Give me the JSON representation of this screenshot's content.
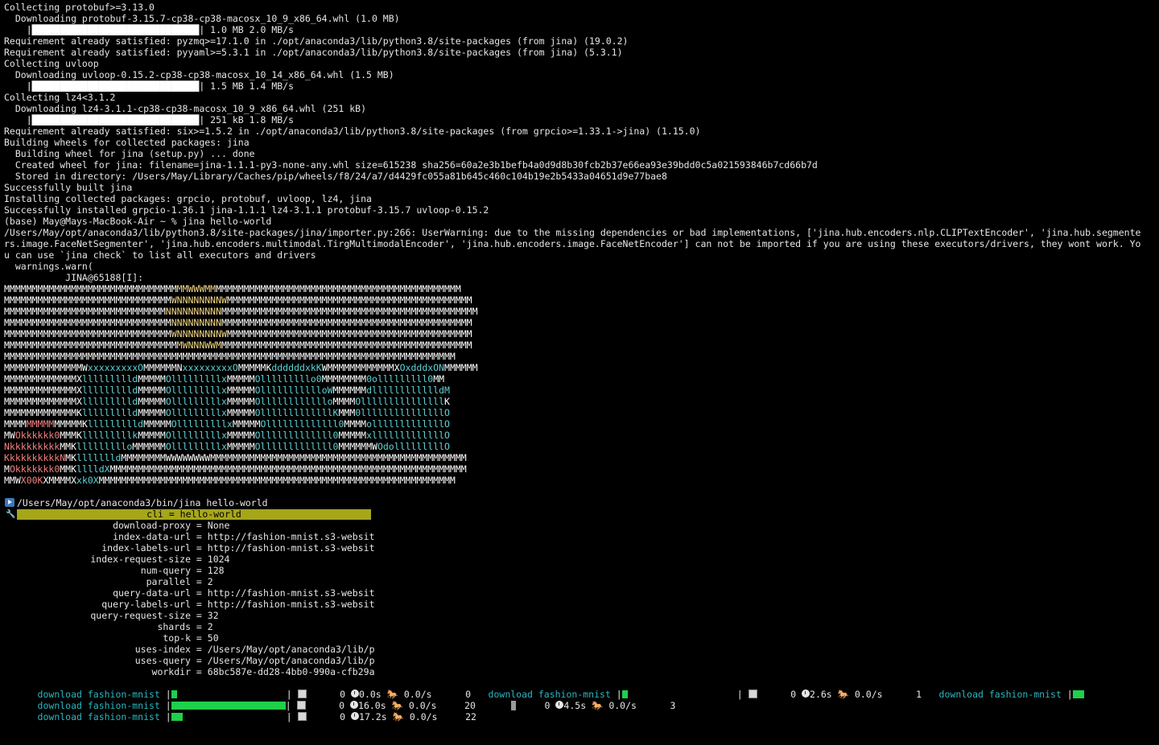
{
  "install_log": [
    "Collecting protobuf>=3.13.0",
    "  Downloading protobuf-3.15.7-cp38-cp38-macosx_10_9_x86_64.whl (1.0 MB)",
    "@BAR@| 1.0 MB 2.0 MB/s",
    "Requirement already satisfied: pyzmq>=17.1.0 in ./opt/anaconda3/lib/python3.8/site-packages (from jina) (19.0.2)",
    "Requirement already satisfied: pyyaml>=5.3.1 in ./opt/anaconda3/lib/python3.8/site-packages (from jina) (5.3.1)",
    "Collecting uvloop",
    "  Downloading uvloop-0.15.2-cp38-cp38-macosx_10_14_x86_64.whl (1.5 MB)",
    "@BAR@| 1.5 MB 1.4 MB/s",
    "Collecting lz4<3.1.2",
    "  Downloading lz4-3.1.1-cp38-cp38-macosx_10_9_x86_64.whl (251 kB)",
    "@BAR@| 251 kB 1.8 MB/s",
    "Requirement already satisfied: six>=1.5.2 in ./opt/anaconda3/lib/python3.8/site-packages (from grpcio>=1.33.1->jina) (1.15.0)",
    "Building wheels for collected packages: jina",
    "  Building wheel for jina (setup.py) ... done",
    "  Created wheel for jina: filename=jina-1.1.1-py3-none-any.whl size=615238 sha256=60a2e3b1befb4a0d9d8b30fcb2b37e66ea93e39bdd0c5a021593846b7cd66b7d",
    "  Stored in directory: /Users/May/Library/Caches/pip/wheels/f8/24/a7/d4429fc055a81b645c460c104b19e2b5433a04651d9e77bae8",
    "Successfully built jina",
    "Installing collected packages: grpcio, protobuf, uvloop, lz4, jina",
    "Successfully installed grpcio-1.36.1 jina-1.1.1 lz4-3.1.1 protobuf-3.15.7 uvloop-0.15.2",
    "(base) May@Mays-MacBook-Air ~ % jina hello-world",
    "/Users/May/opt/anaconda3/lib/python3.8/site-packages/jina/importer.py:266: UserWarning: due to the missing dependencies or bad implementations, ['jina.hub.encoders.nlp.CLIPTextEncoder', 'jina.hub.segmente",
    "rs.image.FaceNetSegmenter', 'jina.hub.encoders.multimodal.TirgMultimodalEncoder', 'jina.hub.encoders.image.FaceNetEncoder'] can not be imported if you are using these executors/drivers, they wont work. Yo",
    "u can use `jina check` to list all executors and drivers",
    "  warnings.warn(",
    "           JINA@65188[I]:"
  ],
  "bar_glyphs": "    |██████████████████████████████",
  "logo": [
    [
      [
        "w",
        "MMMMMMMMMMMMMMMMMMMMMMMMMMMMMMM"
      ],
      [
        "y",
        "MMWWWMM"
      ],
      [
        "w",
        "MMMMMMMMMMMMMMMMMMMMMMMMMMMMMMMMMMMMMMMMMMMM"
      ]
    ],
    [
      [
        "w",
        "MMMMMMMMMMMMMMMMMMMMMMMMMMMMMM"
      ],
      [
        "y",
        "WNNNNNNNNW"
      ],
      [
        "w",
        "MMMMMMMMMMMMMMMMMMMMMMMMMMMMMMMMMMMMMMMMMMMM"
      ]
    ],
    [
      [
        "w",
        "MMMMMMMMMMMMMMMMMMMMMMMMMMMMM"
      ],
      [
        "y",
        "NNNNNNNNNN"
      ],
      [
        "w",
        "MMMMMMMMMMMMMMMMMMMMMMMMMMMMMMMMMMMMMMMMMMMMMM"
      ]
    ],
    [
      [
        "w",
        "MMMMMMMMMMMMMMMMMMMMMMMMMMMMMM"
      ],
      [
        "y",
        "NNNNNNNNN"
      ],
      [
        "w",
        "MMMMMMMMMMMMMMMMMMMMMMMMMMMMMMMMMMMMMMMMMMMMM"
      ]
    ],
    [
      [
        "w",
        "MMMMMMMMMMMMMMMMMMMMMMMMMMMMMM"
      ],
      [
        "y",
        "WNNNNNNNNW"
      ],
      [
        "w",
        "MMMMMMMMMMMMMMMMMMMMMMMMMMMMMMMMMMMMMMMMMMMM"
      ]
    ],
    [
      [
        "w",
        "MMMMMMMMMMMMMMMMMMMMMMMMMMMMMMM"
      ],
      [
        "y",
        "MWNNNWWM"
      ],
      [
        "w",
        "MMMMMMMMMMMMMMMMMMMMMMMMMMMMMMMMMMMMMMMMMMMMM"
      ]
    ],
    [
      [
        "w",
        "MMMMMMMMMMMMMMMMMMMMMMMMMMMMMMMMMMMMMMMMMMMMMMMMMMMMMMMMMMMMMMMMMMMMMMMMMMMMMMMMM"
      ]
    ],
    [
      [
        "w",
        "MMMMMMMMMMMMMMW"
      ],
      [
        "c",
        "xxxxxxxxxO"
      ],
      [
        "w",
        "MMMMMMN"
      ],
      [
        "c",
        "xxxxxxxxxO"
      ],
      [
        "w",
        "MMMMMK"
      ],
      [
        "c",
        "ddddddxkK"
      ],
      [
        "w",
        "WMMMMMMMMMMMMX"
      ],
      [
        "c",
        "OxdddxON"
      ],
      [
        "w",
        "MMMMMM"
      ]
    ],
    [
      [
        "w",
        "MMMMMMMMMMMMMX"
      ],
      [
        "c",
        "llllllllld"
      ],
      [
        "w",
        "MMMMM"
      ],
      [
        "c",
        "Olllllllllx"
      ],
      [
        "w",
        "MMMMM"
      ],
      [
        "c",
        "Olllllllllo0"
      ],
      [
        "w",
        "MMMMMMMM"
      ],
      [
        "c",
        "0olllllllll0"
      ],
      [
        "w",
        "MM"
      ]
    ],
    [
      [
        "w",
        "MMMMMMMMMMMMMX"
      ],
      [
        "c",
        "llllllllld"
      ],
      [
        "w",
        "MMMMM"
      ],
      [
        "c",
        "Olllllllllx"
      ],
      [
        "w",
        "MMMMM"
      ],
      [
        "c",
        "OllllllllllloW"
      ],
      [
        "w",
        "MMMMMM"
      ],
      [
        "c",
        "dlllllllllllldM"
      ]
    ],
    [
      [
        "w",
        "MMMMMMMMMMMMMX"
      ],
      [
        "c",
        "llllllllld"
      ],
      [
        "w",
        "MMMMM"
      ],
      [
        "c",
        "Olllllllllx"
      ],
      [
        "w",
        "MMMMM"
      ],
      [
        "c",
        "Ollllllllllllo"
      ],
      [
        "w",
        "MMMM"
      ],
      [
        "c",
        "Olllllllllllllll"
      ],
      [
        "w",
        "K"
      ]
    ],
    [
      [
        "w",
        "MMMMMMMMMMMMMK"
      ],
      [
        "c",
        "llllllllld"
      ],
      [
        "w",
        "MMMMM"
      ],
      [
        "c",
        "Olllllllllx"
      ],
      [
        "w",
        "MMMMM"
      ],
      [
        "c",
        "OlllllllllllllK"
      ],
      [
        "w",
        "MMM"
      ],
      [
        "c",
        "0lllllllllllllllO"
      ]
    ],
    [
      [
        "w",
        "MMMM"
      ],
      [
        "r",
        "MMMMM"
      ],
      [
        "w",
        "MMMMMK"
      ],
      [
        "c",
        "llllllllld"
      ],
      [
        "w",
        "MMMMM"
      ],
      [
        "c",
        "Olllllllllx"
      ],
      [
        "w",
        "MMMMM"
      ],
      [
        "c",
        "Olllllllllllll0"
      ],
      [
        "w",
        "MMMM"
      ],
      [
        "c",
        "olllllllllllllO"
      ]
    ],
    [
      [
        "w",
        "MW"
      ],
      [
        "r",
        "Okkkkkk0"
      ],
      [
        "w",
        "MMMK"
      ],
      [
        "c",
        "lllllllllk"
      ],
      [
        "w",
        "MMMMM"
      ],
      [
        "c",
        "Olllllllllx"
      ],
      [
        "w",
        "MMMMM"
      ],
      [
        "c",
        "Olllllllllllll0"
      ],
      [
        "w",
        "MMMMM"
      ],
      [
        "c",
        "xlllllllllllllO"
      ]
    ],
    [
      [
        "r",
        "Nkkkkkkkkk"
      ],
      [
        "w",
        "MMK"
      ],
      [
        "c",
        "lllllllllo"
      ],
      [
        "w",
        "MMMMMM"
      ],
      [
        "c",
        "Olllllllllx"
      ],
      [
        "w",
        "MMMMM"
      ],
      [
        "c",
        "Olllllllllllll0"
      ],
      [
        "w",
        "MMMMMMW"
      ],
      [
        "c",
        "OdolllllllllO"
      ]
    ],
    [
      [
        "r",
        "KkkkkkkkkkN"
      ],
      [
        "w",
        "MK"
      ],
      [
        "c",
        "llllllld"
      ],
      [
        "w",
        "MMMMMMMMWWWWWWWW"
      ],
      [
        "w",
        "MMMMMMMMMMMMMMMMMMMMMMMMMMMMMMMMMMMMMMMMMMMMMM"
      ]
    ],
    [
      [
        "w",
        "M"
      ],
      [
        "r",
        "Okkkkkkk0"
      ],
      [
        "w",
        "MMK"
      ],
      [
        "c",
        "lllldX"
      ],
      [
        "w",
        "MMMMMMMMMMMMMMMMMMMMMMMMMMMMMMMMMMMMMMMMMMMMMMMMMMMMMMMMMMMMMMMM"
      ]
    ],
    [
      [
        "w",
        "MMW"
      ],
      [
        "r",
        "X00K"
      ],
      [
        "w",
        "XMMMMX"
      ],
      [
        "c",
        "xk0X"
      ],
      [
        "w",
        "MMMMMMMMMMMMMMMMMMMMMMMMMMMMMMMMMMMMMMMMMMMMMMMMMMMMMMMMMMMMMMMM"
      ]
    ]
  ],
  "run_header": {
    "path": "/Users/May/opt/anaconda3/bin/jina hello-world",
    "cli": "cli = hello-world"
  },
  "args": [
    {
      "k": "download-proxy",
      "v": "None"
    },
    {
      "k": "index-data-url",
      "v": "http://fashion-mnist.s3-websit"
    },
    {
      "k": "index-labels-url",
      "v": "http://fashion-mnist.s3-websit"
    },
    {
      "k": "index-request-size",
      "v": "1024"
    },
    {
      "k": "num-query",
      "v": "128"
    },
    {
      "k": "parallel",
      "v": "2"
    },
    {
      "k": "query-data-url",
      "v": "http://fashion-mnist.s3-websit"
    },
    {
      "k": "query-labels-url",
      "v": "http://fashion-mnist.s3-websit"
    },
    {
      "k": "query-request-size",
      "v": "32"
    },
    {
      "k": "shards",
      "v": "2"
    },
    {
      "k": "top-k",
      "v": "50"
    },
    {
      "k": "uses-index",
      "v": "/Users/May/opt/anaconda3/lib/p"
    },
    {
      "k": "uses-query",
      "v": "/Users/May/opt/anaconda3/lib/p"
    },
    {
      "k": "workdir",
      "v": "68bc587e-dd28-4bb0-990a-cfb29a"
    }
  ],
  "progress": {
    "label": "download fashion-mnist",
    "row1": {
      "a": {
        "fill": 0.05,
        "count": "0",
        "time": "0.0s",
        "rate": "0.0/s",
        "idx": "0"
      },
      "b": {
        "fill": 0.05,
        "count": "0",
        "time": "2.6s",
        "rate": "0.0/s",
        "idx": "1"
      },
      "c": {
        "fill": 0.5
      }
    },
    "row2": {
      "a": {
        "fill": 1.0,
        "count": "0",
        "time": "16.0s",
        "rate": "0.0/s",
        "idx": "20"
      },
      "b": {
        "count": "0",
        "time": "4.5s",
        "rate": "0.0/s",
        "idx": "3"
      }
    },
    "row3": {
      "a": {
        "fill": 0.1,
        "count": "0",
        "time": "17.2s",
        "rate": "0.0/s",
        "idx": "22"
      }
    }
  }
}
